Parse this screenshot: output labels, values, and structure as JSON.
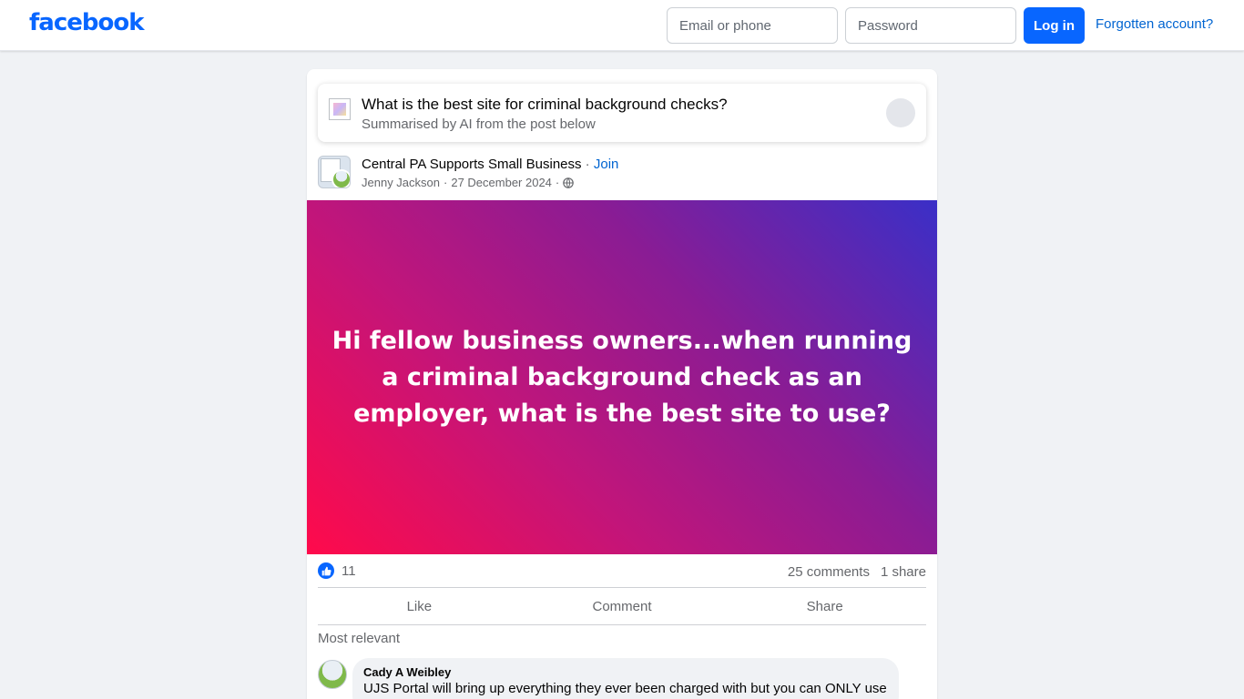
{
  "topbar": {
    "logo": "facebook",
    "email_placeholder": "Email or phone",
    "password_placeholder": "Password",
    "login_label": "Log in",
    "forgot_label": "Forgotten account?"
  },
  "ai_summary": {
    "title": "What is the best site for criminal background checks?",
    "subtitle": "Summarised by AI from the post below"
  },
  "post": {
    "group_name": "Central PA Supports Small Business",
    "separator": " · ",
    "join_label": "Join",
    "author": "Jenny Jackson",
    "date": "27 December 2024",
    "audience_icon": "globe-icon",
    "text": "Hi fellow business owners...when running a criminal background check as an employer, what is the best site to use?",
    "gradient_colors": [
      "#ff0a4b",
      "#c2157a",
      "#8a1c94",
      "#3a2fc7"
    ],
    "reaction_icon": "like-icon",
    "reaction_count": "11",
    "comments_count": "25 comments",
    "shares_count": "1 share"
  },
  "actions": {
    "like": "Like",
    "comment": "Comment",
    "share": "Share"
  },
  "comments": {
    "sort_label": "Most relevant",
    "items": [
      {
        "author": "Cady A Weibley",
        "text": "UJS Portal will bring up everything they ever been charged with but you can ONLY use"
      }
    ]
  },
  "colors": {
    "brand": "#0866ff",
    "link": "#0064d1",
    "background": "#f0f2f5"
  }
}
